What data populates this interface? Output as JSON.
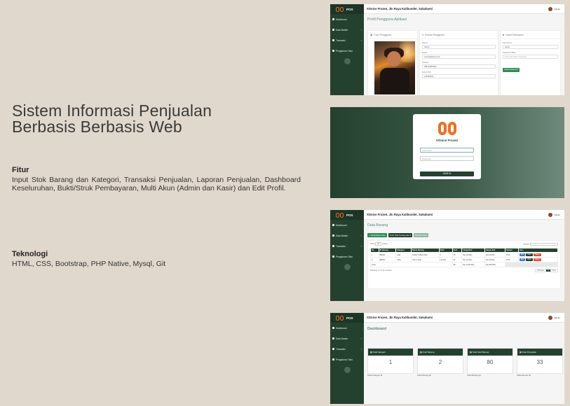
{
  "title_line1": "Sistem Informasi Penjualan",
  "title_line2": "Berbasis Berbasis Web",
  "fitur": {
    "heading": "Fitur",
    "text": "Input Stok Barang dan Kategori, Transaksi Penjualan, Laporan Penjualan, Dashboard Keseluruhan, Bukti/Struk Pembayaran, Multi Akun (Admin dan Kasir) dan Edit Profil."
  },
  "teknologi": {
    "heading": "Teknologi",
    "text": "HTML, CSS, Bootstrap, PHP Native, Mysql, Git"
  },
  "app": {
    "brand": "POS",
    "store": "XOnice Frozen, Jln Raya Kalibunder, Sukabumi",
    "user": "Admin",
    "sidebar": [
      "Dashboard",
      "Data Master",
      "Transaksi",
      "Pengaturan Toko"
    ],
    "accent": "#24412f",
    "logo_color": "#f26d21"
  },
  "profile": {
    "page_title": "Profil Pengguna Aplikasi",
    "photo_card": "Foto Pengguna",
    "data_card": "Kelola Pengguna",
    "pass_card": "Ganti Password",
    "fields": [
      {
        "label": "Nama",
        "value": "Admin"
      },
      {
        "label": "Email",
        "value": "xonice@frozen.com"
      },
      {
        "label": "Telepon",
        "value": "085734987690"
      },
      {
        "label": "NIK (KTP)",
        "value": "123456233"
      }
    ],
    "username_label": "Username",
    "username_value": "admin",
    "newpass_label": "Password Baru",
    "newpass_placeholder": "Enter Pass Baru Password",
    "change_button": "Ubah Password"
  },
  "login": {
    "title": "XOnice Frozen",
    "user_placeholder": "Username",
    "pass_placeholder": "Password",
    "button": "SIGN IN"
  },
  "barang": {
    "page_title": "Data Barang",
    "buttons": [
      "+ Tambahkan Data",
      "Sortir Stok Kurang dari 3",
      "Refresh Data"
    ],
    "show_label": "Show",
    "entries_label": "entries",
    "search_label": "Search:",
    "columns": [
      "No.",
      "ID Barang",
      "Kategori",
      "Nama Barang",
      "Merk",
      "Stok",
      "Harga Beli",
      "Harga Jual",
      "Satuan",
      "Aksi"
    ],
    "rows": [
      [
        "1",
        "BR001",
        "ssfd",
        "SUSU KUDA LIAR",
        "?",
        "76",
        "Rp.12.000,-",
        "Rp.15.000,-",
        "PCS"
      ],
      [
        "2",
        "BR002",
        "Tahu",
        "Tahu Lebar",
        "Lamber",
        "22",
        "Rp.12.000,-",
        "Rp.15.000,-",
        "PCS"
      ]
    ],
    "total_label": "Total",
    "total_stok": "98",
    "total_beli": "Rp.1.020.000,-",
    "total_jual": "Rp.356.000,-",
    "actions": [
      "Edit",
      "Ubah",
      "Hapus"
    ],
    "info": "Showing 1 to 2 of 2 entries",
    "pagination": [
      "Previous",
      "1",
      "Next"
    ]
  },
  "dashboard": {
    "page_title": "Dashboard",
    "cards": [
      {
        "title": "Total Kategori",
        "value": "1",
        "link": "Tabel Kategori"
      },
      {
        "title": "Total Barang",
        "value": "2",
        "link": "Tabel Barang"
      },
      {
        "title": "Total Stok Barang",
        "value": "80",
        "link": "Tabel Barang"
      },
      {
        "title": "Total Penjualan",
        "value": "33",
        "link": "Tabel laporan"
      }
    ]
  }
}
